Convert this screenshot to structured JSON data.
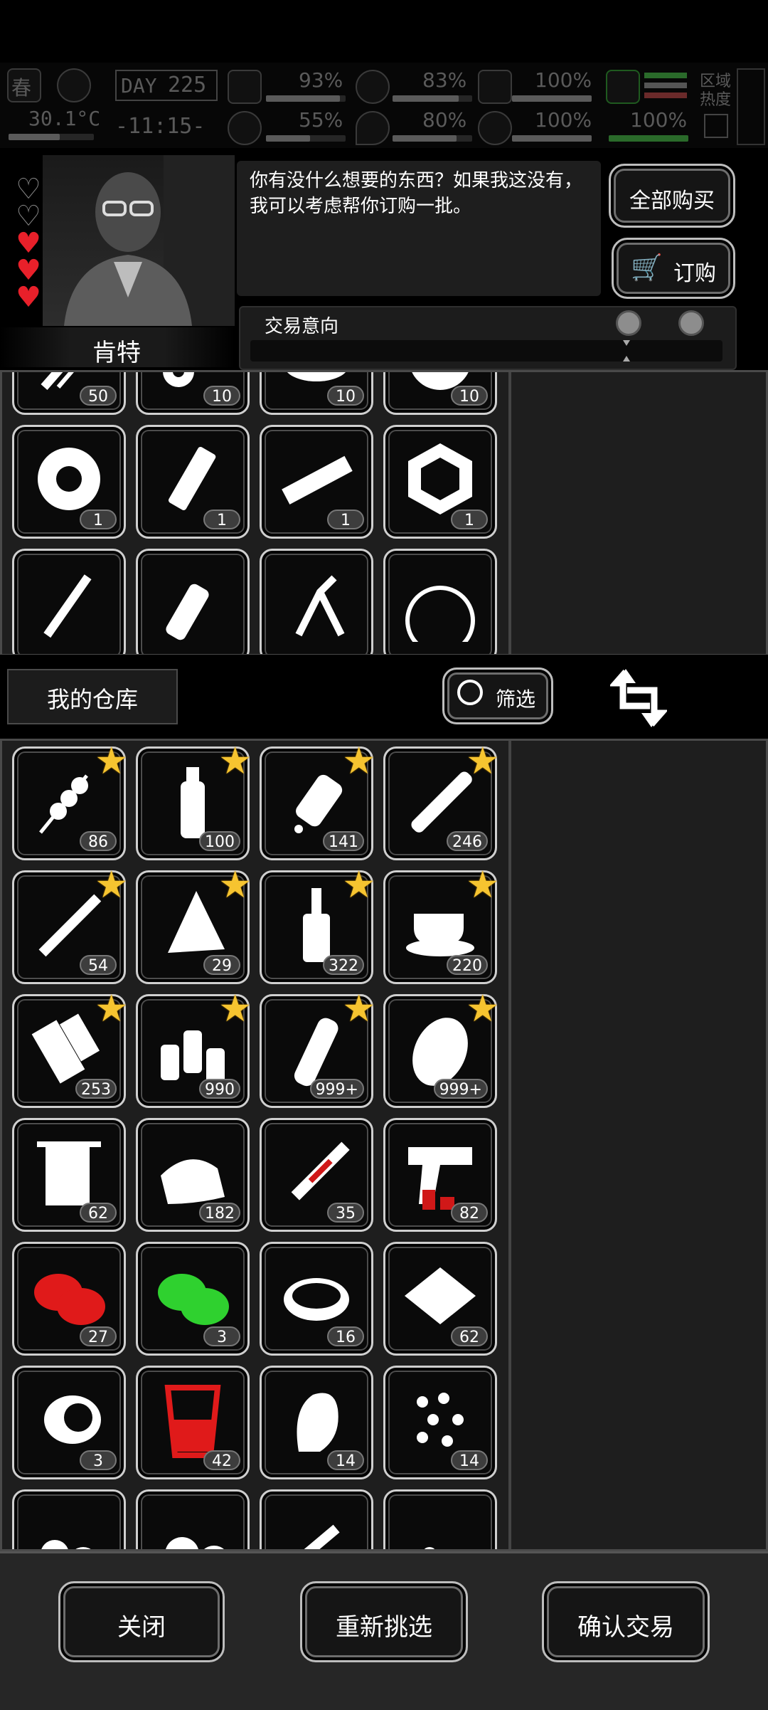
{
  "hud": {
    "season": "春",
    "day_label": "DAY",
    "day": "225",
    "temperature": "30.1°C",
    "time": "-11:15-",
    "stats": [
      {
        "name": "health",
        "value": "93%",
        "level": 0.93
      },
      {
        "name": "mental",
        "value": "55%",
        "level": 0.55
      },
      {
        "name": "hunger",
        "value": "83%",
        "level": 0.83
      },
      {
        "name": "thirst",
        "value": "80%",
        "level": 0.8
      },
      {
        "name": "stamina",
        "value": "100%",
        "level": 1.0
      },
      {
        "name": "mood",
        "value": "100%",
        "level": 1.0
      },
      {
        "name": "zone",
        "value": "100%",
        "level": 1.0
      }
    ],
    "zone_heat_label": "区域热度"
  },
  "trader": {
    "name": "肯特",
    "hearts": [
      "empty",
      "empty",
      "full",
      "full",
      "full"
    ],
    "dialogue": "你有没什么想要的东西？如果我这没有，我可以考虑帮你订购一批。",
    "buy_all_label": "全部购买",
    "order_label": "订购",
    "trade_intent_label": "交易意向"
  },
  "trader_items": [
    {
      "icon": "rope-icon",
      "count": "50"
    },
    {
      "icon": "gears-icon",
      "count": "10"
    },
    {
      "icon": "rubble-icon",
      "count": "10"
    },
    {
      "icon": "cotton-icon",
      "count": "10"
    },
    {
      "icon": "tape-roll-icon",
      "count": "1"
    },
    {
      "icon": "glue-tube-icon",
      "count": "1"
    },
    {
      "icon": "wood-plank-icon",
      "count": "1"
    },
    {
      "icon": "weight-icon",
      "count": "1"
    },
    {
      "icon": "stick-icon",
      "count": ""
    },
    {
      "icon": "spray-bottle-icon",
      "count": ""
    },
    {
      "icon": "pliers-icon",
      "count": ""
    },
    {
      "icon": "net-ball-icon",
      "count": ""
    }
  ],
  "warehouse": {
    "title": "我的仓库",
    "filter_label": "筛选",
    "items": [
      {
        "icon": "kebab-icon",
        "count": "86",
        "star": true
      },
      {
        "icon": "water-bottle-icon",
        "count": "100",
        "star": true
      },
      {
        "icon": "pill-bottle-icon",
        "count": "141",
        "star": true
      },
      {
        "icon": "cigar-icon",
        "count": "246",
        "star": true
      },
      {
        "icon": "cigarette-icon",
        "count": "54",
        "star": true
      },
      {
        "icon": "pizza-slice-icon",
        "count": "29",
        "star": true
      },
      {
        "icon": "liquor-bottle-icon",
        "count": "322",
        "star": true
      },
      {
        "icon": "coffee-cup-icon",
        "count": "220",
        "star": true
      },
      {
        "icon": "bandage-icon",
        "count": "253",
        "star": true
      },
      {
        "icon": "sauce-bottles-icon",
        "count": "990",
        "star": true
      },
      {
        "icon": "soda-bottle-icon",
        "count": "999+",
        "star": true
      },
      {
        "icon": "potato-icon",
        "count": "999+",
        "star": true
      },
      {
        "icon": "towel-icon",
        "count": "62",
        "star": false
      },
      {
        "icon": "cloth-roll-icon",
        "count": "182",
        "star": false
      },
      {
        "icon": "syringe-icon",
        "count": "35",
        "star": false
      },
      {
        "icon": "flare-gun-icon",
        "count": "82",
        "star": false
      },
      {
        "icon": "red-herb-icon",
        "count": "27",
        "star": false,
        "color": "#e01a1a"
      },
      {
        "icon": "green-herb-icon",
        "count": "3",
        "star": false,
        "color": "#2fd12f"
      },
      {
        "icon": "soup-bowl-icon",
        "count": "16",
        "star": false
      },
      {
        "icon": "cracker-plate-icon",
        "count": "62",
        "star": false
      },
      {
        "icon": "gas-mask-icon",
        "count": "3",
        "star": false
      },
      {
        "icon": "red-drink-icon",
        "count": "42",
        "star": false,
        "color": "#e01a1a"
      },
      {
        "icon": "ginger-icon",
        "count": "14",
        "star": false
      },
      {
        "icon": "seeds-icon",
        "count": "14",
        "star": false
      },
      {
        "icon": "nuts-icon",
        "count": "",
        "star": false
      },
      {
        "icon": "pills-icon",
        "count": "",
        "star": false
      },
      {
        "icon": "dropper-icon",
        "count": "",
        "star": false
      },
      {
        "icon": "capsules-icon",
        "count": "",
        "star": false
      }
    ]
  },
  "footer": {
    "close_label": "关闭",
    "reselect_label": "重新挑选",
    "confirm_label": "确认交易"
  }
}
